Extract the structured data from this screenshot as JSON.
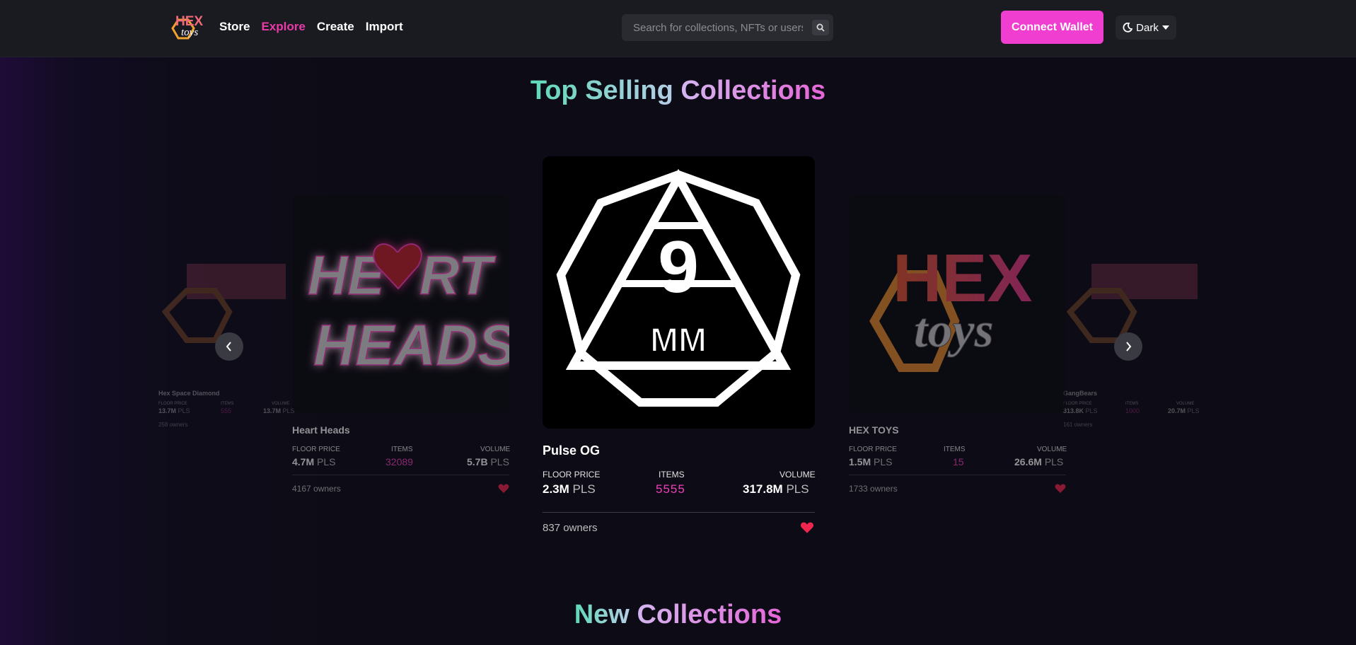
{
  "header": {
    "logo_text_top": "HEX",
    "logo_text_bottom": "toys",
    "nav": [
      {
        "label": "Store",
        "active": false
      },
      {
        "label": "Explore",
        "active": true
      },
      {
        "label": "Create",
        "active": false
      },
      {
        "label": "Import",
        "active": false
      }
    ],
    "search": {
      "placeholder": "Search for collections, NFTs or users",
      "value": ""
    },
    "connect_label": "Connect Wallet",
    "theme_label": "Dark"
  },
  "top_selling": {
    "heading_part1": "Top Selling",
    "heading_part2": "Collections",
    "cards": {
      "center": {
        "name": "Pulse OG",
        "floor_label": "FLOOR PRICE",
        "floor_value": "2.3M",
        "floor_unit": "PLS",
        "items_label": "ITEMS",
        "items_value": "5555",
        "volume_label": "VOLUME",
        "volume_value": "317.8M",
        "volume_unit": "PLS",
        "owners": "837 owners",
        "image_text": "9",
        "image_subtext": "MM"
      },
      "left": {
        "name": "Heart Heads",
        "floor_label": "FLOOR PRICE",
        "floor_value": "4.7M",
        "floor_unit": "PLS",
        "items_label": "ITEMS",
        "items_value": "32089",
        "volume_label": "VOLUME",
        "volume_value": "5.7B",
        "volume_unit": "PLS",
        "owners": "4167 owners",
        "image_text_1": "HE",
        "image_text_2": "RT",
        "image_text_3": "HEADS"
      },
      "right": {
        "name": "HEX TOYS",
        "floor_label": "FLOOR PRICE",
        "floor_value": "1.5M",
        "floor_unit": "PLS",
        "items_label": "ITEMS",
        "items_value": "15",
        "volume_label": "VOLUME",
        "volume_value": "26.6M",
        "volume_unit": "PLS",
        "owners": "1733 owners",
        "image_text_1": "HEX",
        "image_text_2": "toys"
      },
      "far_left": {
        "name": "Hex Space Diamond",
        "floor_label": "FLOOR PRICE",
        "floor_value": "13.7M",
        "floor_unit": "PLS",
        "items_label": "ITEMS",
        "items_value": "555",
        "volume_label": "VOLUME",
        "volume_value": "13.7M",
        "volume_unit": "PLS",
        "owners": "258 owners"
      },
      "far_right": {
        "name": "GangBears",
        "floor_label": "FLOOR PRICE",
        "floor_value": "313.8K",
        "floor_unit": "PLS",
        "items_label": "ITEMS",
        "items_value": "1000",
        "volume_label": "VOLUME",
        "volume_value": "20.7M",
        "volume_unit": "PLS",
        "owners": "161 owners"
      }
    }
  },
  "new_collections": {
    "heading_part1": "New",
    "heading_part2": "Collections"
  },
  "colors": {
    "accent_pink": "#f03ed0",
    "nav_active": "#e83aa8",
    "heading_teal": "#5fd9b8",
    "heading_violet": "#e565d8",
    "heart_red": "#f0264e",
    "items_pink": "#f13fb9"
  }
}
